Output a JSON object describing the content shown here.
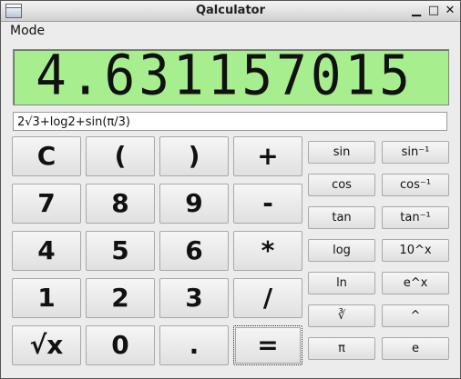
{
  "window": {
    "title": "Qalculator",
    "minimize": "▁",
    "maximize": "□",
    "close": "✕"
  },
  "menu": {
    "mode": "Mode"
  },
  "display": {
    "value": "4.631157015"
  },
  "expression": {
    "value": "2√3+log2+sin(π/3)"
  },
  "keypad": {
    "clear": "C",
    "lparen": "(",
    "rparen": ")",
    "plus": "+",
    "seven": "7",
    "eight": "8",
    "nine": "9",
    "minus": "-",
    "four": "4",
    "five": "5",
    "six": "6",
    "multiply": "*",
    "one": "1",
    "two": "2",
    "three": "3",
    "divide": "/",
    "sqrt": "√x",
    "zero": "0",
    "dot": ".",
    "equals": "="
  },
  "functions": {
    "sin": "sin",
    "asin": "sin⁻¹",
    "cos": "cos",
    "acos": "cos⁻¹",
    "tan": "tan",
    "atan": "tan⁻¹",
    "log": "log",
    "pow10": "10^x",
    "ln": "ln",
    "exp": "e^x",
    "cbrt": "∛",
    "power": "^",
    "pi": "π",
    "e": "e"
  },
  "colors": {
    "display_bg": "#a7ef8e",
    "window_bg": "#ececec"
  }
}
